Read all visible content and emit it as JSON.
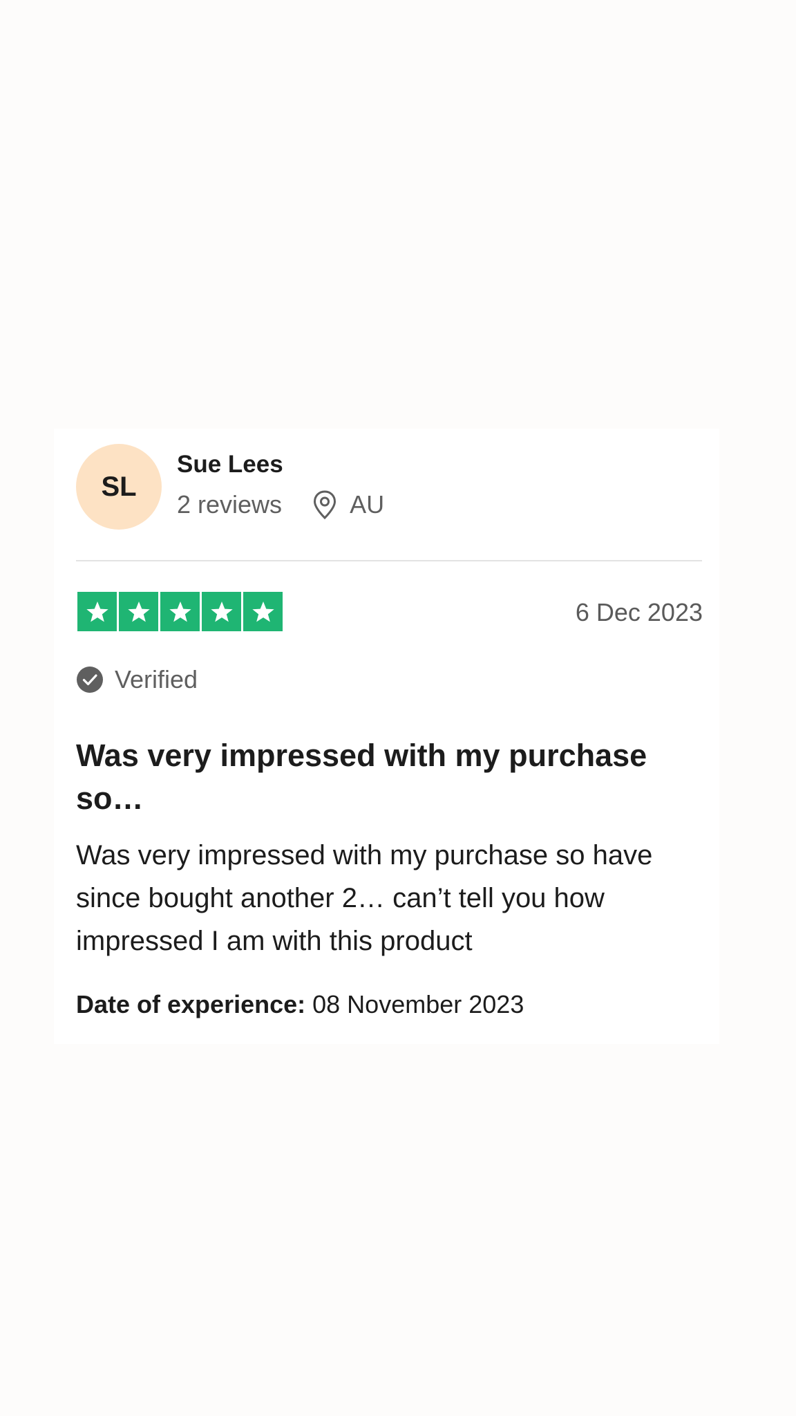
{
  "review": {
    "avatar_initials": "SL",
    "avatar_color": "#fde2c4",
    "reviewer_name": "Sue Lees",
    "review_count": "2 reviews",
    "location": "AU",
    "rating": 5,
    "rating_max": 5,
    "star_color": "#1fb573",
    "date": "6 Dec 2023",
    "verified_label": "Verified",
    "title": "Was very impressed with my purchase so…",
    "body": "Was very impressed with my purchase so have since bought another 2… can’t tell you how impressed I am with this product",
    "experience_label": "Date of experience:",
    "experience_date": "08 November 2023"
  },
  "icons": [
    "location-pin-icon",
    "star-icon",
    "verified-check-icon"
  ]
}
